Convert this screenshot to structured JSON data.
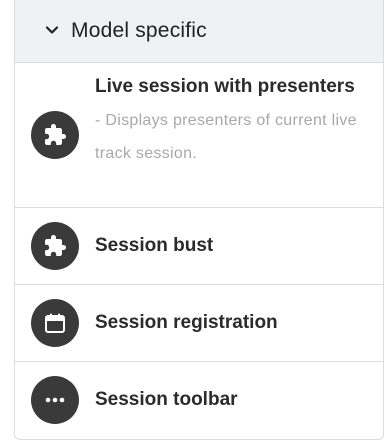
{
  "section": {
    "title": "Model specific",
    "icon": "chevron-down-icon"
  },
  "items": [
    {
      "label": "Live session with presenters",
      "separator": " - ",
      "description": "Displays presenters of current live track session.",
      "icon": "puzzle-piece-icon"
    },
    {
      "label": "Session bust",
      "icon": "puzzle-piece-icon"
    },
    {
      "label": "Session registration",
      "icon": "calendar-icon"
    },
    {
      "label": "Session toolbar",
      "icon": "ellipsis-icon"
    }
  ],
  "colors": {
    "header_background": "#f0f1f2",
    "icon_background": "#3a3a3a",
    "description_text": "#a8a8a8",
    "border": "#dcdcdc"
  }
}
